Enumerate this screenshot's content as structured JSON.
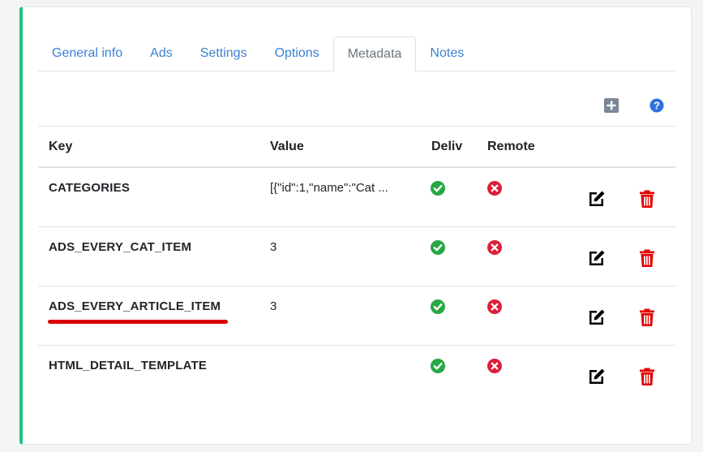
{
  "tabs": [
    {
      "label": "General info"
    },
    {
      "label": "Ads"
    },
    {
      "label": "Settings"
    },
    {
      "label": "Options"
    },
    {
      "label": "Metadata"
    },
    {
      "label": "Notes"
    }
  ],
  "active_tab": "Metadata",
  "toolbar": {
    "add_icon": "plus-square-icon",
    "help_icon": "question-circle-icon"
  },
  "table": {
    "headers": {
      "key": "Key",
      "value": "Value",
      "deliv": "Deliv",
      "remote": "Remote"
    },
    "rows": [
      {
        "key": "CATEGORIES",
        "value": "[{\"id\":1,\"name\":\"Cat ...",
        "deliv": true,
        "remote": false
      },
      {
        "key": "ADS_EVERY_CAT_ITEM",
        "value": "3",
        "deliv": true,
        "remote": false
      },
      {
        "key": "ADS_EVERY_ARTICLE_ITEM",
        "value": "3",
        "deliv": true,
        "remote": false,
        "highlighted": true
      },
      {
        "key": "HTML_DETAIL_TEMPLATE",
        "value": "",
        "deliv": true,
        "remote": false
      }
    ]
  },
  "colors": {
    "accent_border": "#1fc37d",
    "link": "#3d7fd1",
    "check": "#28a745",
    "cross": "#dc1f3a",
    "delete": "#e30000",
    "highlight_underline": "#d80000"
  }
}
